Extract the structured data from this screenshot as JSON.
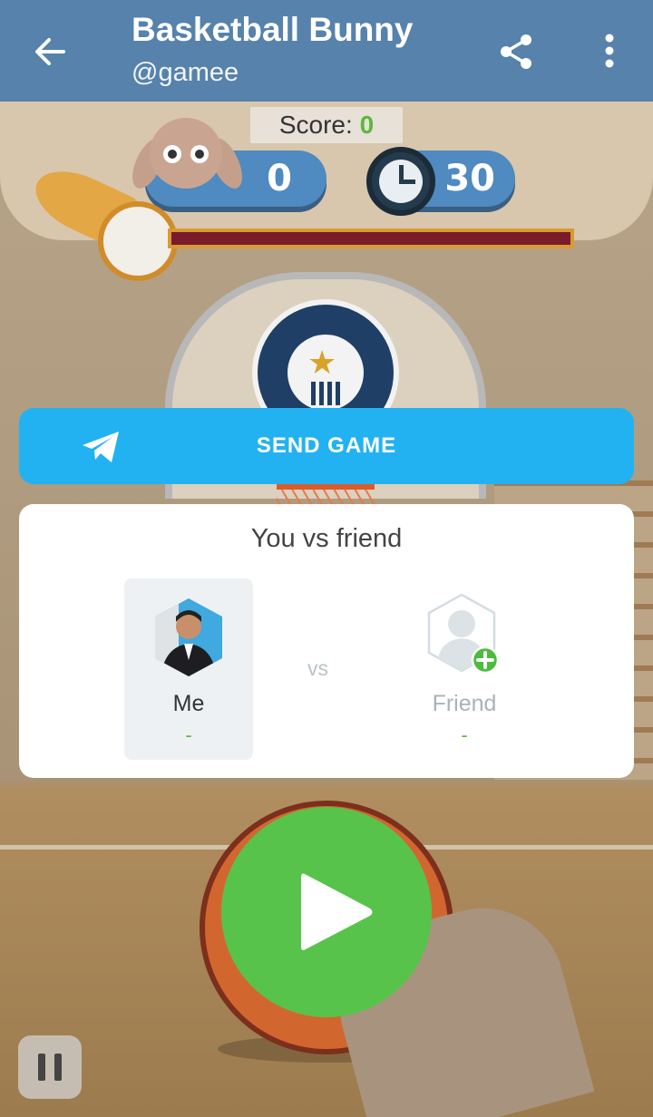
{
  "app_bar": {
    "title": "Basketball Bunny",
    "subtitle": "@gamee",
    "back_icon": "arrow-left-icon",
    "share_icon": "share-icon",
    "more_icon": "more-vertical-icon"
  },
  "game": {
    "score_label": "Score: ",
    "score_value": "0",
    "player_points": "0",
    "timer_seconds": "30"
  },
  "send_game": {
    "label": "SEND GAME",
    "icon": "telegram-plane-icon"
  },
  "versus_card": {
    "title": "You vs friend",
    "vs_label": "vs",
    "me": {
      "name": "Me",
      "score": "-"
    },
    "friend": {
      "name": "Friend",
      "score": "-",
      "icon": "add-friend-icon"
    }
  },
  "controls": {
    "play_icon": "play-icon",
    "pause_icon": "pause-icon"
  },
  "colors": {
    "app_bar": "#5682ac",
    "send_button": "#22b2f1",
    "play_button": "#58c34a",
    "score_value": "#5cb83c"
  }
}
